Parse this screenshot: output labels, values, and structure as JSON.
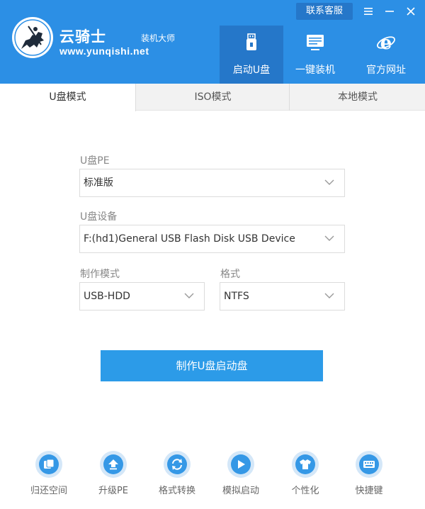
{
  "header": {
    "brand_name": "云骑士",
    "brand_sub": "装机大师",
    "brand_url": "www.yunqishi.net",
    "contact_label": "联系客服",
    "accent_color": "#2c8fe5",
    "nav": [
      {
        "label": "启动U盘",
        "icon": "usb-icon"
      },
      {
        "label": "一键装机",
        "icon": "monitor-icon"
      },
      {
        "label": "官方网址",
        "icon": "ie-icon"
      }
    ]
  },
  "tabs": [
    {
      "label": "U盘模式"
    },
    {
      "label": "ISO模式"
    },
    {
      "label": "本地模式"
    }
  ],
  "form": {
    "pe_label": "U盘PE",
    "pe_value": "标准版",
    "device_label": "U盘设备",
    "device_value": "F:(hd1)General USB Flash Disk USB Device",
    "mode_label": "制作模式",
    "mode_value": "USB-HDD",
    "format_label": "格式",
    "format_value": "NTFS"
  },
  "make_button": "制作U盘启动盘",
  "tools": [
    {
      "label": "归还空间",
      "icon": "restore-space-icon"
    },
    {
      "label": "升级PE",
      "icon": "upgrade-icon"
    },
    {
      "label": "格式转换",
      "icon": "convert-icon"
    },
    {
      "label": "模拟启动",
      "icon": "simulate-boot-icon"
    },
    {
      "label": "个性化",
      "icon": "personalize-icon"
    },
    {
      "label": "快捷键",
      "icon": "keyboard-icon"
    }
  ]
}
